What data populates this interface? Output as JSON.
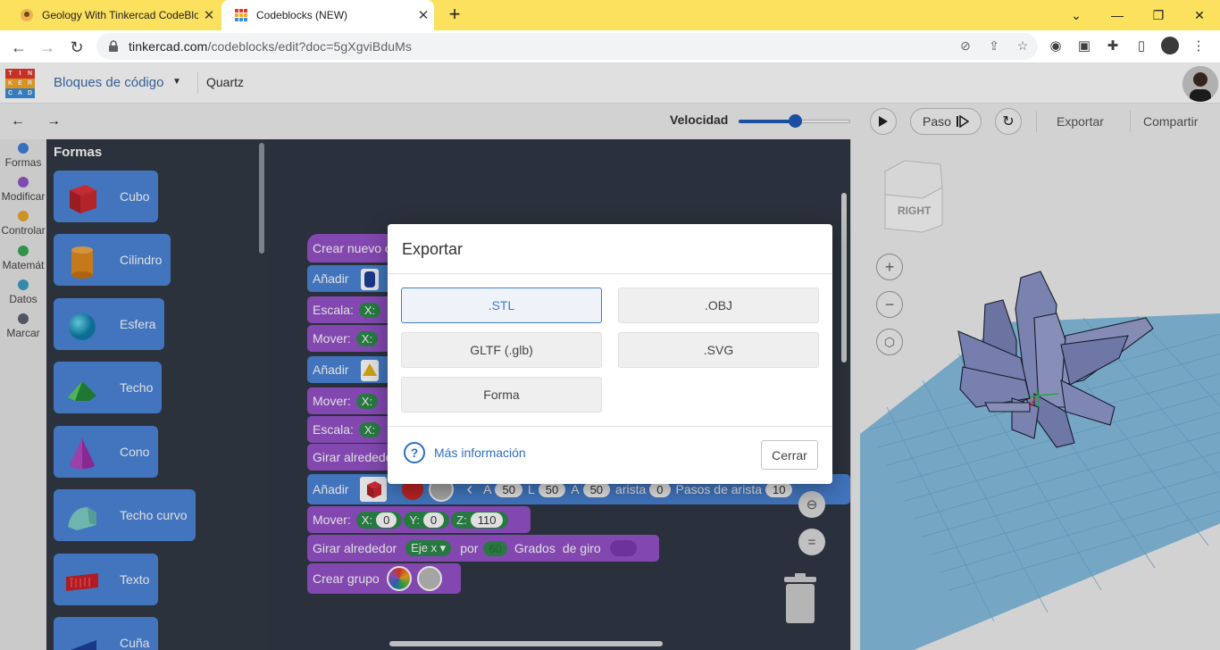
{
  "browser": {
    "tabs": [
      {
        "title": "Geology With Tinkercad CodeBlocks",
        "active": false
      },
      {
        "title": "Codeblocks (NEW)",
        "active": true
      }
    ],
    "url_host": "tinkercad.com",
    "url_path": "/codeblocks/edit?doc=5gXgviBduMs"
  },
  "app": {
    "logo_letters": [
      "T",
      "I",
      "N",
      "K",
      "E",
      "R",
      "C",
      "A",
      "D"
    ],
    "logo_colors": [
      "#e2382d",
      "#e2382d",
      "#e2382d",
      "#f7a823",
      "#f7a823",
      "#f7a823",
      "#3c8fd6",
      "#3c8fd6",
      "#3c8fd6"
    ],
    "app_name": "Bloques de código",
    "doc_name": "Quartz"
  },
  "toolbar": {
    "speed_label": "Velocidad",
    "speed_value": 0.5,
    "step_label": "Paso",
    "export_label": "Exportar",
    "share_label": "Compartir"
  },
  "categories": [
    {
      "label": "Formas",
      "color": "#3f7fd8"
    },
    {
      "label": "Modificar",
      "color": "#9056c6"
    },
    {
      "label": "Controlar",
      "color": "#e8a72a"
    },
    {
      "label": "Matemát",
      "color": "#3aa657"
    },
    {
      "label": "Datos",
      "color": "#3c9ec4"
    },
    {
      "label": "Marcar",
      "color": "#5a6270"
    }
  ],
  "flyout": {
    "title": "Formas",
    "shapes": [
      {
        "label": "Cubo",
        "icon": "cube-icon"
      },
      {
        "label": "Cilindro",
        "icon": "cylinder-icon"
      },
      {
        "label": "Esfera",
        "icon": "sphere-icon"
      },
      {
        "label": "Techo",
        "icon": "roof-icon"
      },
      {
        "label": "Cono",
        "icon": "cone-icon"
      },
      {
        "label": "Techo curvo",
        "icon": "curved-roof-icon"
      },
      {
        "label": "Texto",
        "icon": "text-icon"
      },
      {
        "label": "Cuña",
        "icon": "wedge-icon"
      }
    ]
  },
  "workspace": {
    "blocks": {
      "crear_nuevo": "Crear nuevo o",
      "anadir": "Añadir",
      "escala": "Escala:",
      "mover": "Mover:",
      "girar": "Girar alrededor",
      "crear_grupo": "Crear grupo",
      "x_label": "X:",
      "y_label": "Y:",
      "z_label": "Z:",
      "a_label": "A",
      "l_label": "L",
      "a_value": "50",
      "l_value": "50",
      "a2_value": "50",
      "arista_label": "arista",
      "arista_value": "0",
      "pasos_label": "Pasos de arista",
      "pasos_value": "10",
      "move_x": "0",
      "move_y": "0",
      "move_z": "110",
      "eje_label": "Eje x",
      "por_label": "por",
      "degrees_value": "60",
      "grados_label": "Grados",
      "de_giro_label": "de giro"
    }
  },
  "viewport": {
    "viewcube_label": "RIGHT"
  },
  "modal": {
    "title": "Exportar",
    "formats": [
      ".STL",
      ".OBJ",
      "GLTF (.glb)",
      ".SVG",
      "Forma"
    ],
    "selected": ".STL",
    "info_label": "Más información",
    "close_label": "Cerrar"
  }
}
